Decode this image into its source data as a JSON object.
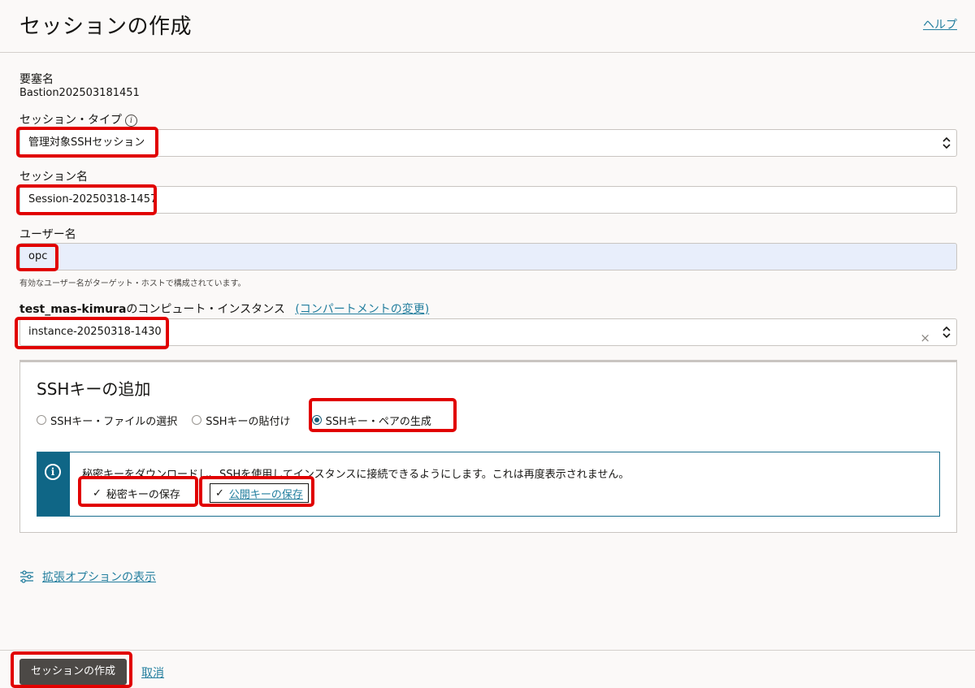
{
  "header": {
    "title": "セッションの作成",
    "help": "ヘルプ"
  },
  "bastion": {
    "label": "要塞名",
    "value": "Bastion202503181451"
  },
  "session_type": {
    "label": "セッション・タイプ",
    "info": "i",
    "value": "管理対象SSHセッション"
  },
  "session_name": {
    "label": "セッション名",
    "value": "Session-20250318-1457"
  },
  "username": {
    "label": "ユーザー名",
    "value": "opc",
    "hint": "有効なユーザー名がターゲット・ホストで構成されています。"
  },
  "instance": {
    "label_bold": "test_mas-kimura",
    "label_rest": "のコンピュート・インスタンス",
    "change_compartment": "(コンパートメントの変更)",
    "value": "instance-20250318-1430",
    "clear": "×"
  },
  "ssh": {
    "title": "SSHキーの追加",
    "options": [
      {
        "label": "SSHキー・ファイルの選択",
        "checked": false
      },
      {
        "label": "SSHキーの貼付け",
        "checked": false
      },
      {
        "label": "SSHキー・ペアの生成",
        "checked": true
      }
    ],
    "info_icon": "i",
    "info_text": "秘密キーをダウンロードし、SSHを使用してインスタンスに接続できるようにします。これは再度表示されません。",
    "save_private": "秘密キーの保存",
    "save_public": "公開キーの保存",
    "check": "✓"
  },
  "advanced": {
    "label": "拡張オプションの表示"
  },
  "footer": {
    "create": "セッションの作成",
    "cancel": "取消"
  },
  "colors": {
    "highlight": "#e10000",
    "link": "#227e9e",
    "info_bar": "#0f6686",
    "primary_button": "#4c4946"
  }
}
